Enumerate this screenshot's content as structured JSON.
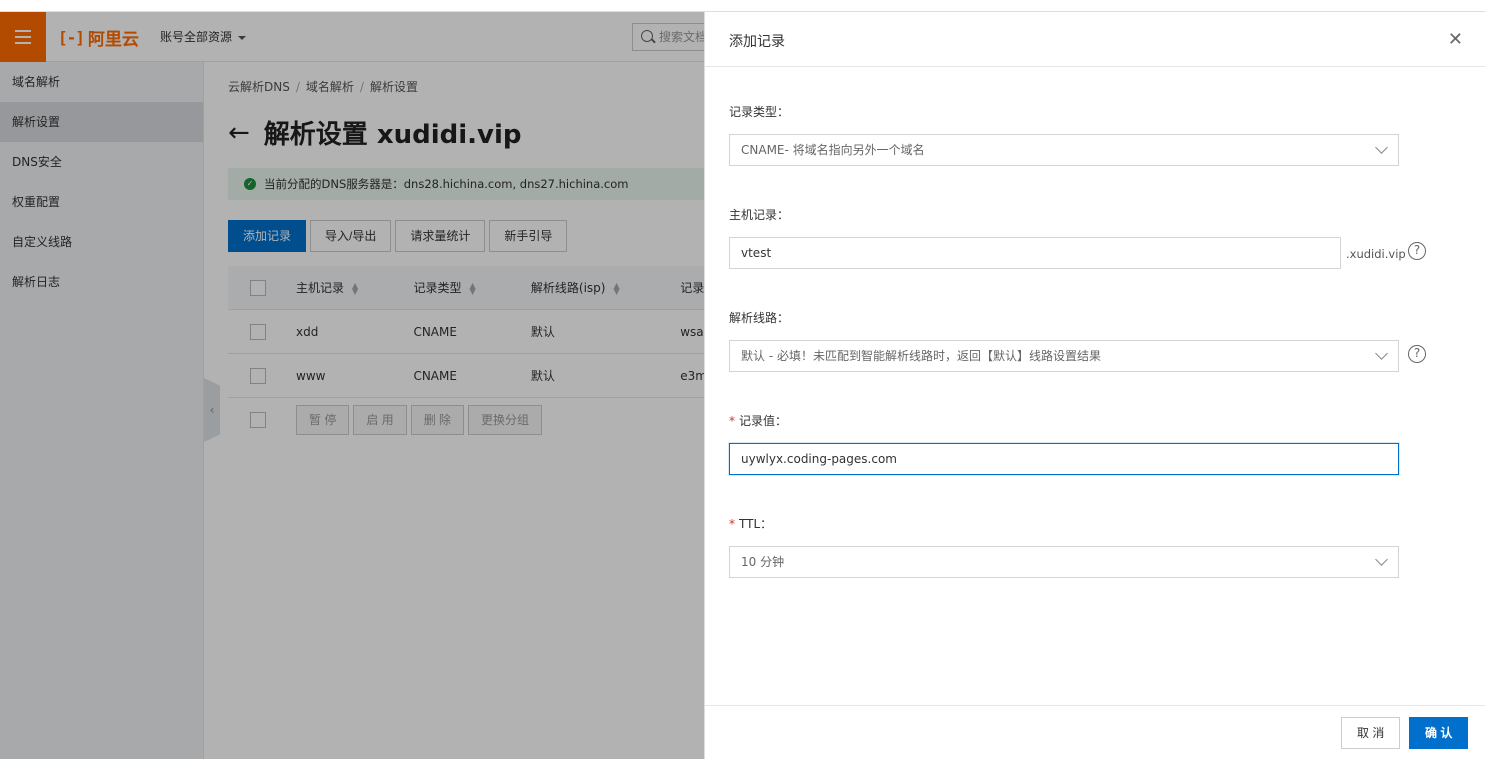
{
  "topbar": {
    "logo_text": "阿里云",
    "account_label": "账号全部资源",
    "search_placeholder": "搜索文档"
  },
  "sidebar": {
    "items": [
      {
        "label": "域名解析"
      },
      {
        "label": "解析设置"
      },
      {
        "label": "DNS安全"
      },
      {
        "label": "权重配置"
      },
      {
        "label": "自定义线路"
      },
      {
        "label": "解析日志"
      }
    ]
  },
  "main": {
    "breadcrumb": [
      "云解析DNS",
      "域名解析",
      "解析设置"
    ],
    "title": "解析设置 xudidi.vip",
    "alert": "当前分配的DNS服务器是：dns28.hichina.com, dns27.hichina.com",
    "toolbar": {
      "add": "添加记录",
      "import_export": "导入/导出",
      "stats": "请求量统计",
      "guide": "新手引导"
    },
    "table": {
      "headers": {
        "host": "主机记录",
        "type": "记录类型",
        "line": "解析线路(isp)",
        "value": "记录"
      },
      "rows": [
        {
          "host": "xdd",
          "type": "CNAME",
          "line": "默认",
          "value": "wsa"
        },
        {
          "host": "www",
          "type": "CNAME",
          "line": "默认",
          "value": "e3m"
        }
      ],
      "batch": {
        "pause": "暂 停",
        "enable": "启 用",
        "delete": "删 除",
        "group": "更换分组"
      }
    }
  },
  "dialog": {
    "title": "添加记录",
    "record_type": {
      "label": "记录类型：",
      "value": "CNAME- 将域名指向另外一个域名"
    },
    "host_record": {
      "label": "主机记录：",
      "value": "vtest",
      "suffix": ".xudidi.vip"
    },
    "line": {
      "label": "解析线路：",
      "value": "默认 - 必填！未匹配到智能解析线路时，返回【默认】线路设置结果"
    },
    "record_value": {
      "label": "记录值：",
      "value": "uywlyx.coding-pages.com"
    },
    "ttl": {
      "label": "TTL：",
      "value": "10 分钟"
    },
    "cancel": "取 消",
    "confirm": "确 认"
  }
}
